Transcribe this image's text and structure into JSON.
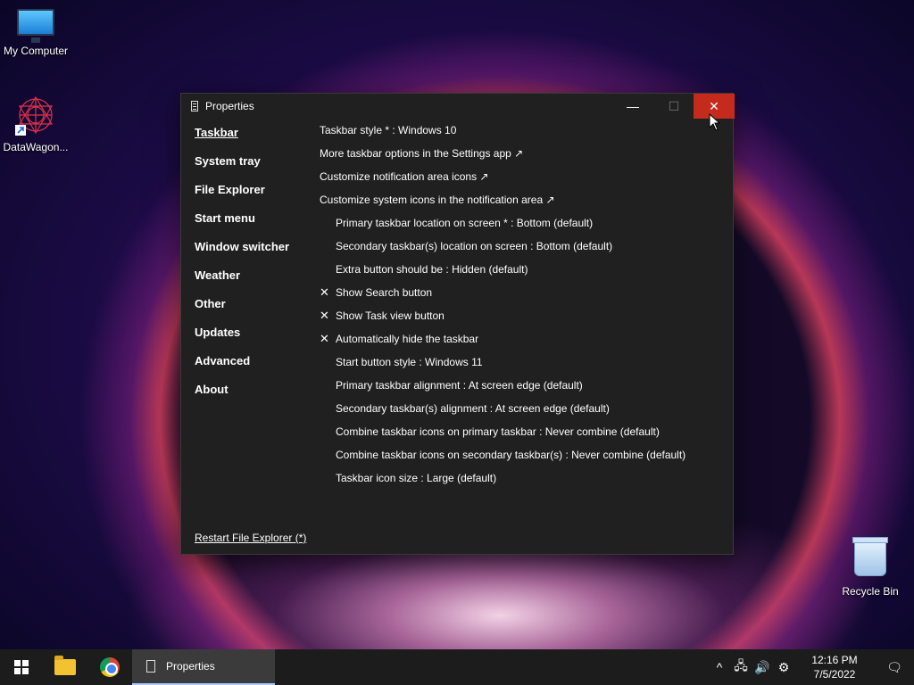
{
  "desktop": {
    "icons": [
      {
        "label": "My Computer"
      },
      {
        "label": "DataWagon..."
      },
      {
        "label": "Recycle Bin"
      }
    ]
  },
  "window": {
    "title": "Properties",
    "controls": {
      "minimize": "—",
      "maximize": "☐",
      "close": "✕"
    },
    "nav": [
      {
        "label": "Taskbar"
      },
      {
        "label": "System tray"
      },
      {
        "label": "File Explorer"
      },
      {
        "label": "Start menu"
      },
      {
        "label": "Window switcher"
      },
      {
        "label": "Weather"
      },
      {
        "label": "Other"
      },
      {
        "label": "Updates"
      },
      {
        "label": "Advanced"
      },
      {
        "label": "About"
      }
    ],
    "settings": [
      {
        "label": "Taskbar style * : Windows 10",
        "check": ""
      },
      {
        "label": "More taskbar options in the Settings app ↗",
        "check": ""
      },
      {
        "label": "Customize notification area icons ↗",
        "check": ""
      },
      {
        "label": "Customize system icons in the notification area ↗",
        "check": ""
      },
      {
        "label": "Primary taskbar location on screen * : Bottom (default)",
        "check": ""
      },
      {
        "label": "Secondary taskbar(s) location on screen : Bottom (default)",
        "check": ""
      },
      {
        "label": "Extra button should be : Hidden (default)",
        "check": ""
      },
      {
        "label": "Show Search button",
        "check": "✕"
      },
      {
        "label": "Show Task view button",
        "check": "✕"
      },
      {
        "label": "Automatically hide the taskbar",
        "check": "✕"
      },
      {
        "label": "Start button style : Windows 11",
        "check": ""
      },
      {
        "label": "Primary taskbar alignment : At screen edge (default)",
        "check": ""
      },
      {
        "label": "Secondary taskbar(s) alignment : At screen edge (default)",
        "check": ""
      },
      {
        "label": "Combine taskbar icons on primary taskbar : Never combine (default)",
        "check": ""
      },
      {
        "label": "Combine taskbar icons on secondary taskbar(s) : Never combine (default)",
        "check": ""
      },
      {
        "label": "Taskbar icon size : Large (default)",
        "check": ""
      }
    ],
    "restart_link": "Restart File Explorer (*)"
  },
  "taskbar": {
    "active_app": "Properties",
    "tray": {
      "chevron": "^",
      "network": "🖧",
      "volume": "🔊",
      "settings": "⚙"
    },
    "clock": {
      "time": "12:16 PM",
      "date": "7/5/2022"
    },
    "notification": "🗨"
  },
  "colors": {
    "close_button": "#c42b1c",
    "window_bg": "#202020",
    "taskbar_bg": "#1c1c1c"
  }
}
